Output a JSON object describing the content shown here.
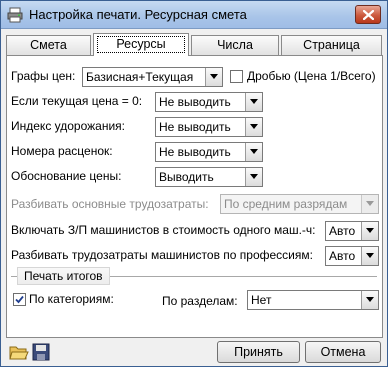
{
  "window": {
    "title": "Настройка печати. Ресурсная смета",
    "app_icon": "printer-settings-icon",
    "close_icon": "close-icon"
  },
  "tabs": [
    {
      "label": "Смета",
      "active": false
    },
    {
      "label": "Ресурсы",
      "active": true
    },
    {
      "label": "Числа",
      "active": false
    },
    {
      "label": "Страница",
      "active": false
    }
  ],
  "form": {
    "columns": {
      "label": "Графы цен:",
      "value": "Базисная+Текущая"
    },
    "fraction": {
      "label": "Дробью (Цена 1/Всего)",
      "checked": false
    },
    "current_price_zero": {
      "label": "Если текущая цена = 0:",
      "value": "Не выводить"
    },
    "price_index": {
      "label": "Индекс удорожания:",
      "value": "Не выводить"
    },
    "rate_numbers": {
      "label": "Номера расценок:",
      "value": "Не выводить"
    },
    "price_justification": {
      "label": "Обоснование цены:",
      "value": "Выводить"
    },
    "split_labor": {
      "label": "Разбивать основные трудозатраты:",
      "value": "По средним разрядам",
      "disabled": true
    },
    "include_wages": {
      "label": "Включать З/П машинистов в стоимость одного маш.-ч:",
      "value": "Авто"
    },
    "split_machinist_labor": {
      "label": "Разбивать трудозатраты машинистов по профессиям:",
      "value": "Авто"
    }
  },
  "totals": {
    "caption": "Печать итогов",
    "by_category": {
      "label": "По категориям:",
      "checked": true
    },
    "by_section": {
      "label": "По разделам:",
      "value": "Нет"
    }
  },
  "bottom": {
    "open_icon": "folder-open-icon",
    "save_icon": "floppy-disk-icon",
    "accept_label": "Принять",
    "cancel_label": "Отмена"
  },
  "colors": {
    "title_bar": "#a8c4e8",
    "close_button": "#cc5a3e",
    "dialog_background": "#f0f0f0"
  }
}
